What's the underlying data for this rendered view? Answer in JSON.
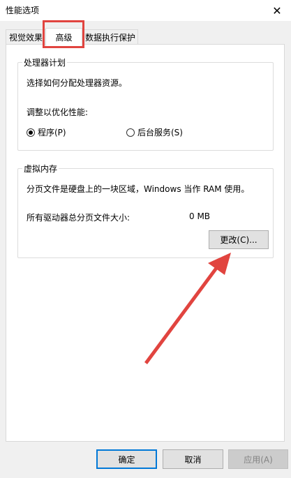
{
  "window": {
    "title": "性能选项",
    "close_label": "✕"
  },
  "tabs": [
    {
      "label": "视觉效果"
    },
    {
      "label": "高级"
    },
    {
      "label": "数据执行保护"
    }
  ],
  "processor": {
    "group_title": "处理器计划",
    "description": "选择如何分配处理器资源。",
    "adjust_label": "调整以优化性能:",
    "option_programs": "程序(P)",
    "option_services": "后台服务(S)"
  },
  "virtual_memory": {
    "group_title": "虚拟内存",
    "description": "分页文件是硬盘上的一块区域，Windows 当作 RAM 使用。",
    "total_label": "所有驱动器总分页文件大小:",
    "total_value": "0 MB",
    "change_button": "更改(C)..."
  },
  "footer": {
    "ok": "确定",
    "cancel": "取消",
    "apply": "应用(A)"
  },
  "colors": {
    "annotation_red": "#e1443f",
    "default_button_border": "#0078d7"
  }
}
